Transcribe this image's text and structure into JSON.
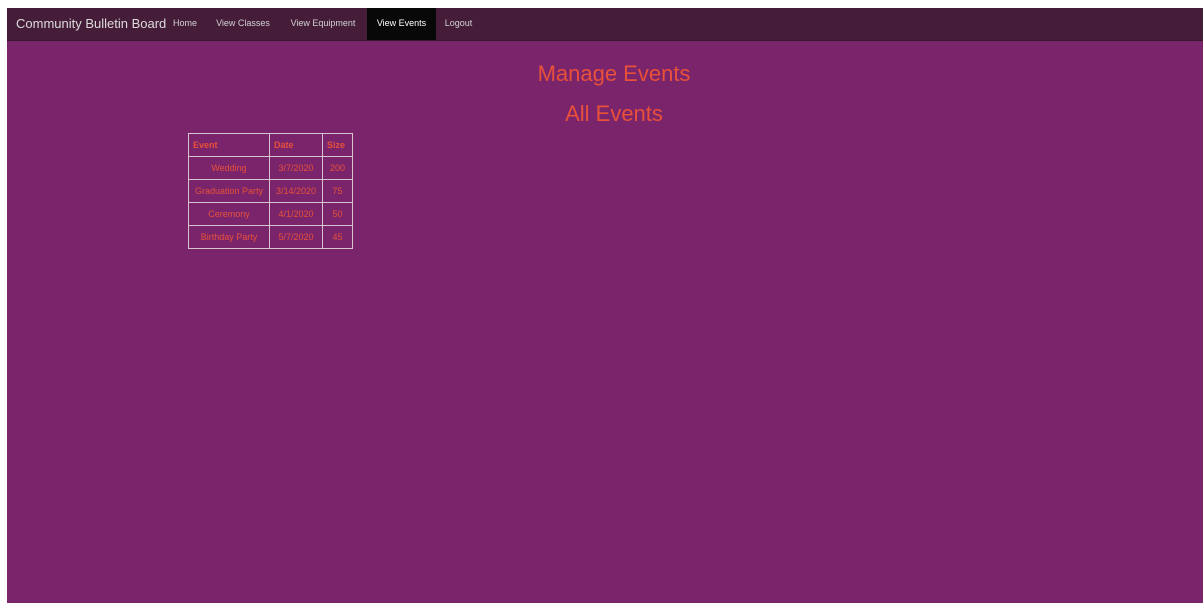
{
  "navbar": {
    "brand": "Community Bulletin Board",
    "items": [
      {
        "label": "Home",
        "active": false
      },
      {
        "label": "View Classes",
        "active": false
      },
      {
        "label": "View Equipment",
        "active": false
      },
      {
        "label": "View Events",
        "active": true
      },
      {
        "label": "Logout",
        "active": false
      }
    ]
  },
  "main": {
    "title": "Manage Events",
    "subtitle": "All Events"
  },
  "events_table": {
    "headers": [
      "Event",
      "Date",
      "Size"
    ],
    "rows": [
      [
        "Wedding",
        "3/7/2020",
        "200"
      ],
      [
        "Graduation Party",
        "3/14/2020",
        "75"
      ],
      [
        "Ceremony",
        "4/1/2020",
        "50"
      ],
      [
        "Birthday Party",
        "5/7/2020",
        "45"
      ]
    ]
  },
  "colors": {
    "page_background": "#7a256b",
    "navbar_background": "#461d38",
    "active_tab_background": "#080808",
    "accent_text": "#e8503a"
  }
}
